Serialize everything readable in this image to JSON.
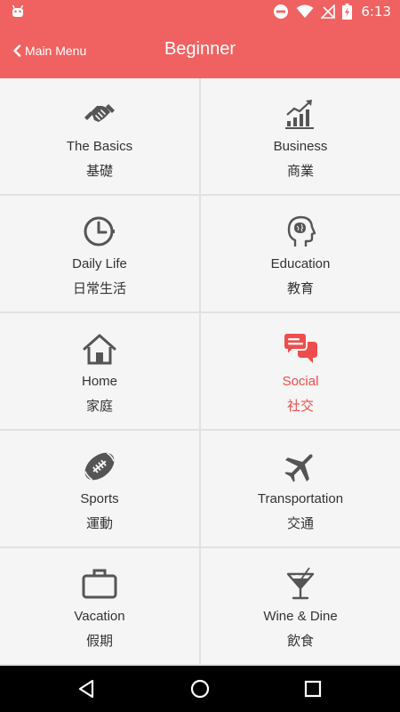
{
  "status_bar": {
    "time": "6:13",
    "icons": [
      "android-icon",
      "do-not-disturb-icon",
      "wifi-icon",
      "no-signal-icon",
      "battery-charging-icon"
    ],
    "color": "#f06262"
  },
  "app_bar": {
    "back_label": "Main Menu",
    "title": "Beginner",
    "color": "#f06262"
  },
  "categories": [
    {
      "en": "The Basics",
      "zh": "基礎",
      "icon": "handshake-icon",
      "active": false
    },
    {
      "en": "Business",
      "zh": "商業",
      "icon": "growth-chart-icon",
      "active": false
    },
    {
      "en": "Daily Life",
      "zh": "日常生活",
      "icon": "clock-icon",
      "active": false
    },
    {
      "en": "Education",
      "zh": "教育",
      "icon": "brain-head-icon",
      "active": false
    },
    {
      "en": "Home",
      "zh": "家庭",
      "icon": "house-icon",
      "active": false
    },
    {
      "en": "Social",
      "zh": "社交",
      "icon": "chat-bubbles-icon",
      "active": true
    },
    {
      "en": "Sports",
      "zh": "運動",
      "icon": "football-icon",
      "active": false
    },
    {
      "en": "Transportation",
      "zh": "交通",
      "icon": "airplane-icon",
      "active": false
    },
    {
      "en": "Vacation",
      "zh": "假期",
      "icon": "suitcase-icon",
      "active": false
    },
    {
      "en": "Wine & Dine",
      "zh": "飲食",
      "icon": "cocktail-icon",
      "active": false
    }
  ],
  "colors": {
    "accent": "#f06262",
    "active_text": "#ef4d4d",
    "icon_gray": "#555555"
  },
  "nav_bar": {
    "icons": [
      "back-triangle-icon",
      "home-circle-icon",
      "recents-square-icon"
    ]
  }
}
